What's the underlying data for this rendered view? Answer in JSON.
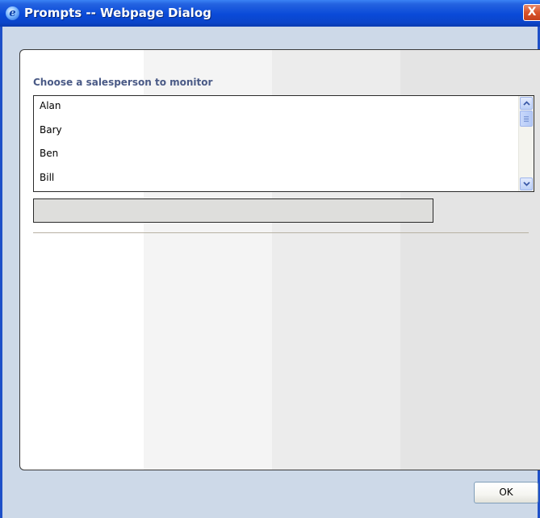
{
  "window": {
    "title": "Prompts -- Webpage Dialog",
    "title_icon": "ie-icon",
    "close_label": "X",
    "titlebar_color": "#0a4ad8",
    "frame_color": "#cdd9e8"
  },
  "prompt": {
    "label": "Choose a salesperson to monitor",
    "label_color": "#4a5a86",
    "list_items": [
      "Alan",
      "Bary",
      "Ben",
      "Bill"
    ],
    "text_value": ""
  },
  "footer": {
    "ok_label": "OK"
  }
}
